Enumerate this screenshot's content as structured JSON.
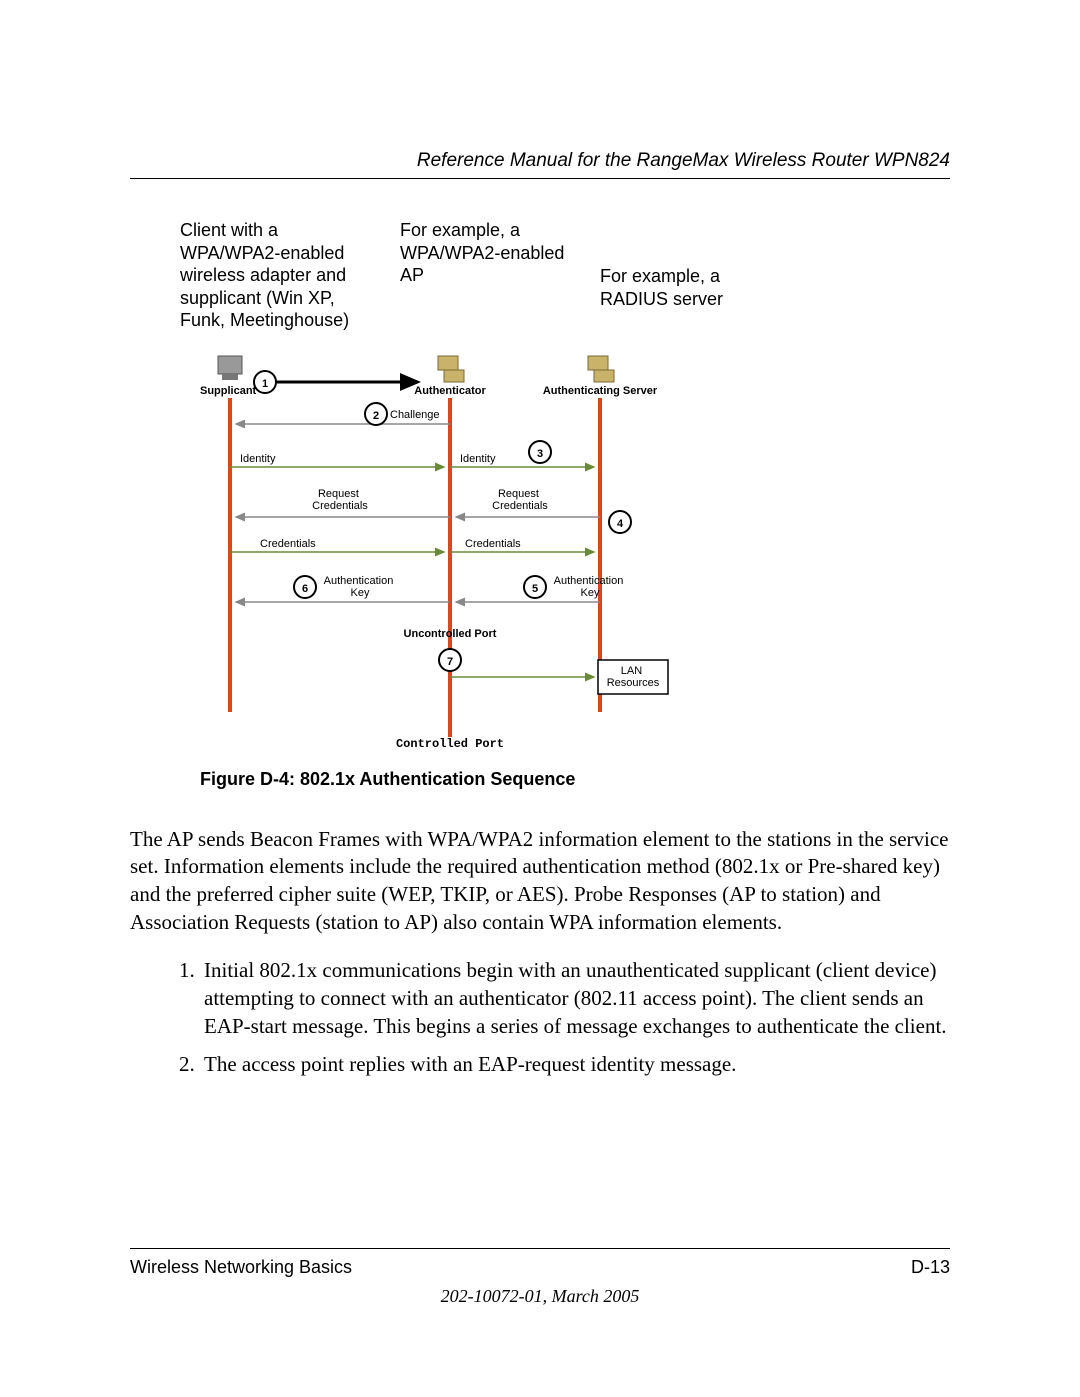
{
  "header": {
    "title": "Reference Manual for the RangeMax Wireless Router WPN824"
  },
  "captions": {
    "col1": "Client with a WPA/WPA2-enabled wireless adapter and supplicant (Win XP, Funk, Meetinghouse)",
    "col2": "For example, a WPA/WPA2-enabled AP",
    "col3": "For example, a RADIUS server"
  },
  "diagram": {
    "entities": {
      "supplicant": "Supplicant",
      "authenticator": "Authenticator",
      "auth_server": "Authenticating Server"
    },
    "steps": {
      "s1": "1",
      "s2": "2",
      "s3": "3",
      "s4": "4",
      "s5": "5",
      "s6": "6",
      "s7": "7"
    },
    "messages": {
      "challenge": "Challenge",
      "identity_l": "Identity",
      "identity_r": "Identity",
      "req_cred_l": "Request\nCredentials",
      "req_cred_r": "Request\nCredentials",
      "cred_l": "Credentials",
      "cred_r": "Credentials",
      "auth_key_l": "Authentication\nKey",
      "auth_key_r": "Authentication\nKey",
      "uncontrolled": "Uncontrolled Port",
      "controlled": "Controlled Port",
      "lan": "LAN\nResources"
    }
  },
  "figure_caption": "Figure D-4:  802.1x Authentication Sequence",
  "body": {
    "para": "The AP sends Beacon Frames with WPA/WPA2 information element to the stations in the service set. Information elements include the required authentication method (802.1x or Pre-shared key) and the preferred cipher suite (WEP, TKIP, or AES). Probe Responses (AP to station) and Association Requests (station to AP) also contain WPA information elements.",
    "list": [
      "Initial 802.1x communications begin with an unauthenticated supplicant (client device) attempting to connect with an authenticator (802.11 access point). The client sends an EAP-start message. This begins a series of message exchanges to authenticate the client.",
      "The access point replies with an EAP-request identity message."
    ]
  },
  "footer": {
    "section": "Wireless Networking Basics",
    "page": "D-13",
    "docid": "202-10072-01, March 2005"
  }
}
